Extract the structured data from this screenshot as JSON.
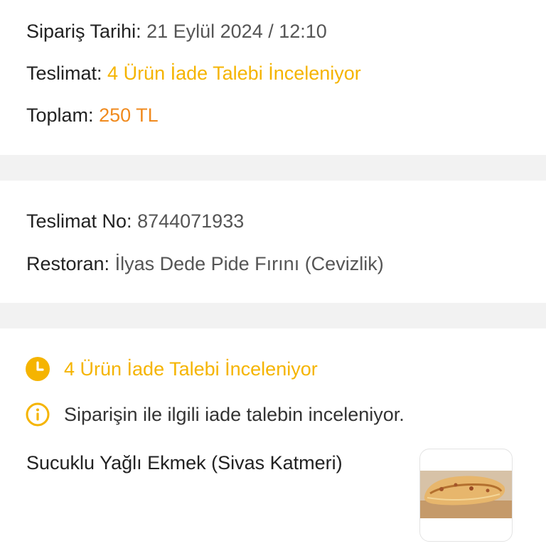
{
  "order": {
    "date_label": "Sipariş Tarihi:",
    "date_value": "21 Eylül 2024 / 12:10",
    "delivery_label": "Teslimat:",
    "delivery_value": "4 Ürün İade Talebi İnceleniyor",
    "total_label": "Toplam:",
    "total_value": "250 TL"
  },
  "delivery": {
    "no_label": "Teslimat No:",
    "no_value": "8744071933",
    "restaurant_label": "Restoran:",
    "restaurant_value": "İlyas Dede Pide Fırını (Cevizlik)"
  },
  "status": {
    "title": "4 Ürün İade Talebi İnceleniyor",
    "title_icon": "clock-icon",
    "info": "Siparişin ile ilgili iade talebin inceleniyor.",
    "info_icon": "info-icon"
  },
  "product": {
    "name": "Sucuklu Yağlı Ekmek (Sivas Katmeri)"
  },
  "colors": {
    "accent_yellow": "#f5b400",
    "accent_orange": "#f08a1e",
    "divider": "#f2f2f2"
  }
}
